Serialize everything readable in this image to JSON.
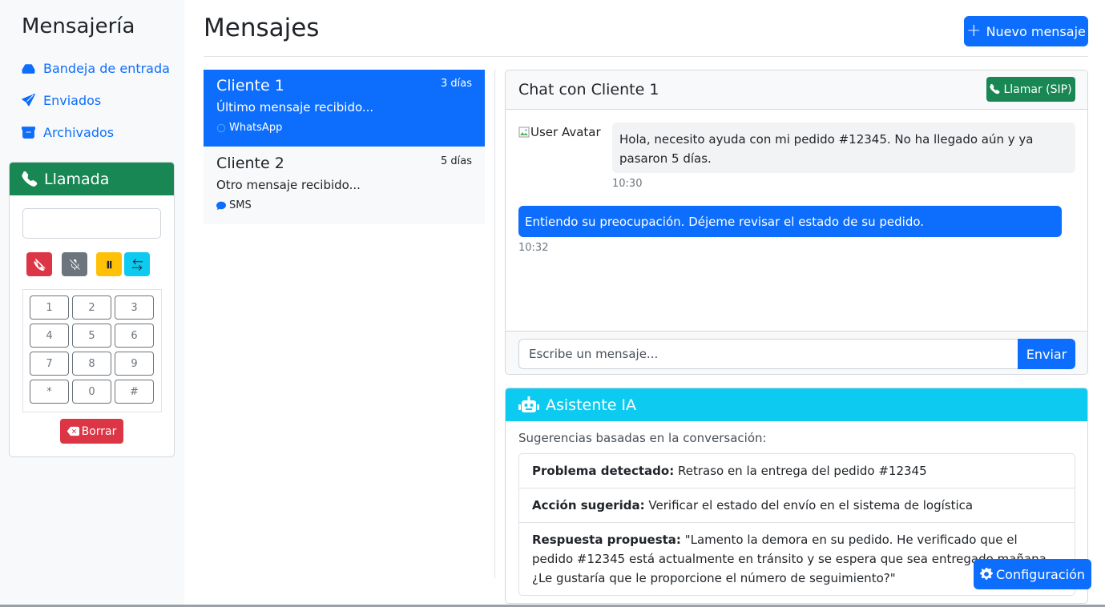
{
  "sidebar": {
    "brand": "Mensajería",
    "nav": [
      {
        "label": "Bandeja de entrada",
        "icon": "inbox-icon"
      },
      {
        "label": "Enviados",
        "icon": "send-icon"
      },
      {
        "label": "Archivados",
        "icon": "archive-icon"
      }
    ],
    "call": {
      "title": "Llamada",
      "number_value": "",
      "controls": [
        {
          "icon": "hangup-icon",
          "color": "#dc3545"
        },
        {
          "icon": "mute-icon",
          "color": "#6c757d"
        },
        {
          "icon": "pause-icon",
          "color": "#ffc107"
        },
        {
          "icon": "transfer-icon",
          "color": "#0dcaf0"
        }
      ],
      "keys": [
        "1",
        "2",
        "3",
        "4",
        "5",
        "6",
        "7",
        "8",
        "9",
        "*",
        "0",
        "#"
      ],
      "delete_label": "Borrar"
    }
  },
  "header": {
    "title": "Mensajes",
    "new_message_label": "Nuevo mensaje"
  },
  "conversations": [
    {
      "name": "Cliente 1",
      "time": "3 días",
      "preview": "Último mensaje recibido...",
      "channel": "WhatsApp",
      "active": true
    },
    {
      "name": "Cliente 2",
      "time": "5 días",
      "preview": "Otro mensaje recibido...",
      "channel": "SMS",
      "active": false
    }
  ],
  "chat": {
    "title": "Chat con Cliente 1",
    "call_label": "Llamar (SIP)",
    "avatar_alt": "User Avatar",
    "messages": [
      {
        "text": "Hola, necesito ayuda con mi pedido #12345. No ha llegado aún y ya pasaron 5 días.",
        "time": "10:30",
        "direction": "in"
      },
      {
        "text": "Entiendo su preocupación. Déjeme revisar el estado de su pedido.",
        "time": "10:32",
        "direction": "out"
      }
    ],
    "input_placeholder": "Escribe un mensaje...",
    "send_label": "Enviar"
  },
  "assistant": {
    "title": "Asistente IA",
    "subtitle": "Sugerencias basadas en la conversación:",
    "items": [
      {
        "label": "Problema detectado:",
        "text": " Retraso en la entrega del pedido #12345"
      },
      {
        "label": "Acción sugerida:",
        "text": " Verificar el estado del envío en el sistema de logística"
      },
      {
        "label": "Respuesta propuesta:",
        "text": " \"Lamento la demora en su pedido. He verificado que el pedido #12345 está actualmente en tránsito y se espera que sea entregado mañana. ¿Le gustaría que le proporcione el número de seguimiento?\""
      }
    ]
  },
  "config_label": "Configuración",
  "colors": {
    "primary": "#0d6efd",
    "success": "#198754",
    "info": "#0dcaf0",
    "danger": "#dc3545",
    "warning": "#ffc107",
    "secondary": "#6c757d"
  }
}
